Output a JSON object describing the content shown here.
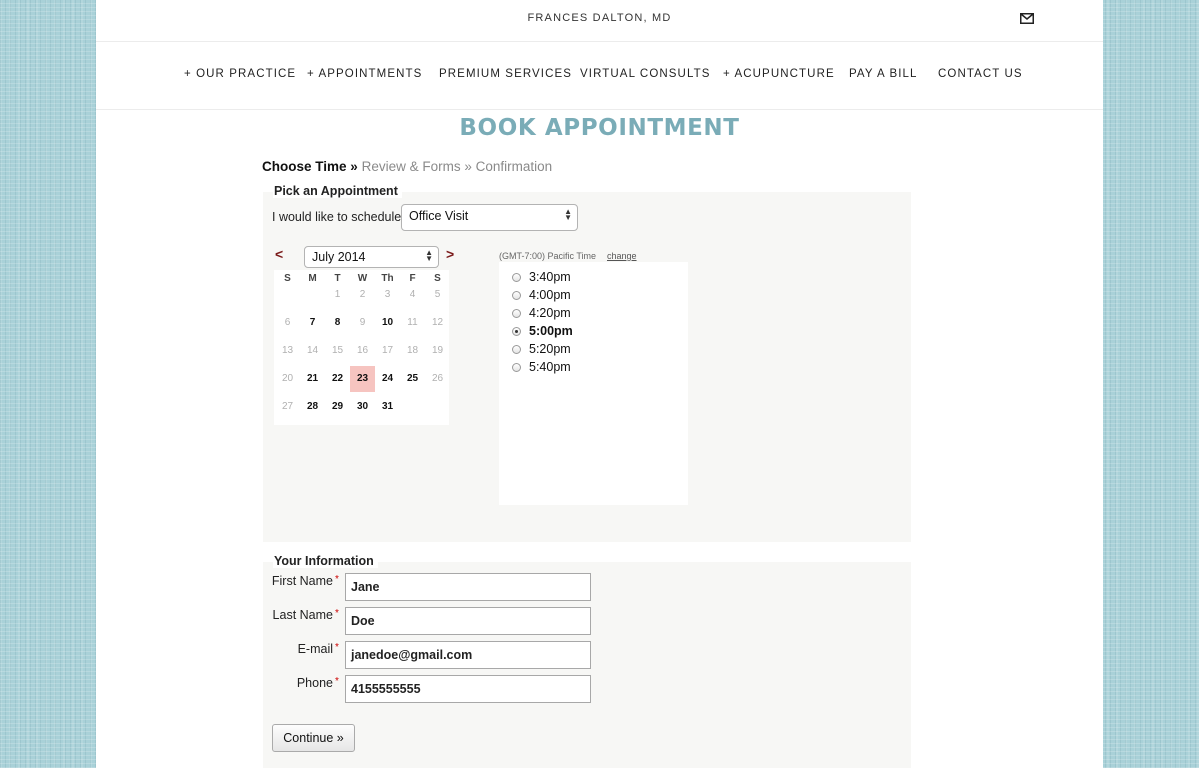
{
  "header": {
    "site_title": "FRANCES DALTON, MD",
    "mail_icon": "envelope-icon"
  },
  "nav": [
    {
      "label": "+ OUR PRACTICE"
    },
    {
      "label": "+ APPOINTMENTS"
    },
    {
      "label": "PREMIUM SERVICES"
    },
    {
      "label": "VIRTUAL CONSULTS"
    },
    {
      "label": "+ ACUPUNCTURE"
    },
    {
      "label": "PAY A BILL"
    },
    {
      "label": "CONTACT US"
    }
  ],
  "page_title": "BOOK APPOINTMENT",
  "breadcrumb": {
    "step1": "Choose Time",
    "sep1": "»",
    "step2": "Review & Forms",
    "sep2": "»",
    "step3": "Confirmation"
  },
  "appointment": {
    "legend": "Pick an Appointment",
    "schedule_label": "I would like to schedule",
    "schedule_value": "Office Visit",
    "prev": "<",
    "next": ">",
    "month_value": "July 2014",
    "weekdays": [
      "S",
      "M",
      "T",
      "W",
      "Th",
      "F",
      "S"
    ],
    "weeks": [
      [
        "",
        "",
        "1",
        "2",
        "3",
        "4",
        "5"
      ],
      [
        "6",
        "7",
        "8",
        "9",
        "10",
        "11",
        "12"
      ],
      [
        "13",
        "14",
        "15",
        "16",
        "17",
        "18",
        "19"
      ],
      [
        "20",
        "21",
        "22",
        "23",
        "24",
        "25",
        "26"
      ],
      [
        "27",
        "28",
        "29",
        "30",
        "31",
        "",
        ""
      ]
    ],
    "available_days": [
      "7",
      "8",
      "10",
      "21",
      "22",
      "23",
      "24",
      "25",
      "28",
      "29",
      "30",
      "31"
    ],
    "selected_day": "23",
    "timezone": "(GMT-7:00) Pacific Time",
    "change_link": "change",
    "times": [
      {
        "label": "3:40pm",
        "checked": false
      },
      {
        "label": "4:00pm",
        "checked": false
      },
      {
        "label": "4:20pm",
        "checked": false
      },
      {
        "label": "5:00pm",
        "checked": true
      },
      {
        "label": "5:20pm",
        "checked": false
      },
      {
        "label": "5:40pm",
        "checked": false
      }
    ]
  },
  "info": {
    "legend": "Your Information",
    "fields": [
      {
        "label": "First Name",
        "value": "Jane"
      },
      {
        "label": "Last Name",
        "value": "Doe"
      },
      {
        "label": "E-mail",
        "value": "janedoe@gmail.com"
      },
      {
        "label": "Phone",
        "value": "4155555555"
      }
    ],
    "required_mark": "*",
    "continue_label": "Continue »"
  },
  "colors": {
    "title": "#7aacb7",
    "selected_day": "#f6c4c0",
    "nav_arrow": "#7a1a1a",
    "background": "#a9d1d8"
  }
}
